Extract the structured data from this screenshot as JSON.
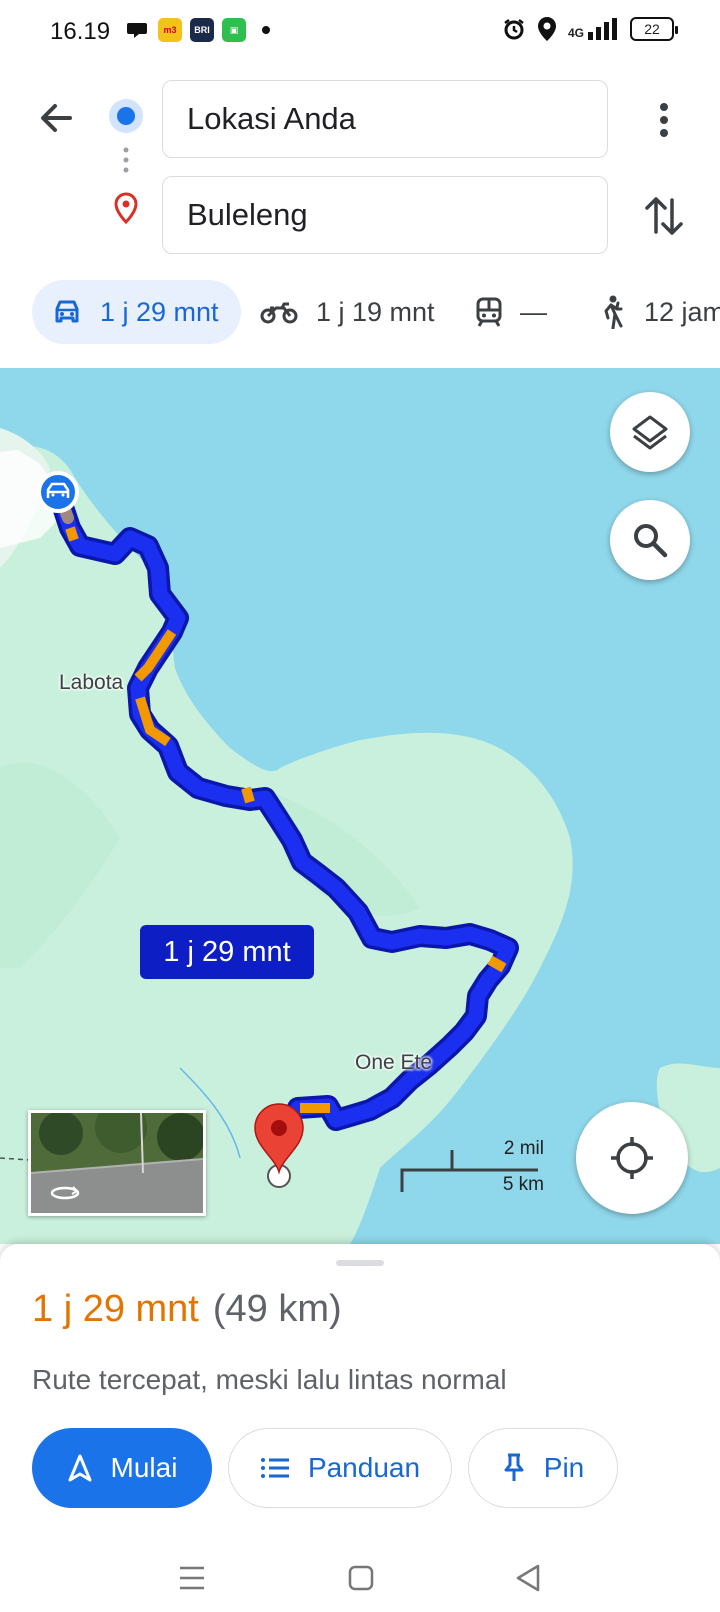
{
  "status_bar": {
    "time": "16.19",
    "app_icons": [
      "chat-bubble-icon",
      "m3-app-icon",
      "brimo-app-icon",
      "shop-app-icon"
    ],
    "network": "4G",
    "battery": "22"
  },
  "header": {
    "origin_value": "Lokasi Anda",
    "destination_value": "Buleleng"
  },
  "modes": [
    {
      "icon": "car-icon",
      "label": "1 j 29 mnt",
      "active": true
    },
    {
      "icon": "motorcycle-icon",
      "label": "1 j 19 mnt",
      "active": false
    },
    {
      "icon": "train-icon",
      "label": "—",
      "active": false
    },
    {
      "icon": "walk-icon",
      "label": "12 jam",
      "active": false
    }
  ],
  "map": {
    "place_labels": [
      "Labota",
      "One Ete"
    ],
    "route_time_callout": "1 j 29 mnt",
    "scale_imperial": "2 mil",
    "scale_metric": "5 km",
    "route_color": "#1a2fef",
    "traffic_slow_color": "#f29900"
  },
  "route": {
    "duration": "1 j 29 mnt",
    "distance": "(49 km)",
    "description": "Rute tercepat, meski lalu lintas normal"
  },
  "actions": {
    "start_label": "Mulai",
    "steps_label": "Panduan",
    "pin_label": "Pin"
  },
  "colors": {
    "accent": "#1a73e8",
    "duration": "#e37400",
    "water": "#8fd7ea",
    "land": "#c9f0dc"
  }
}
